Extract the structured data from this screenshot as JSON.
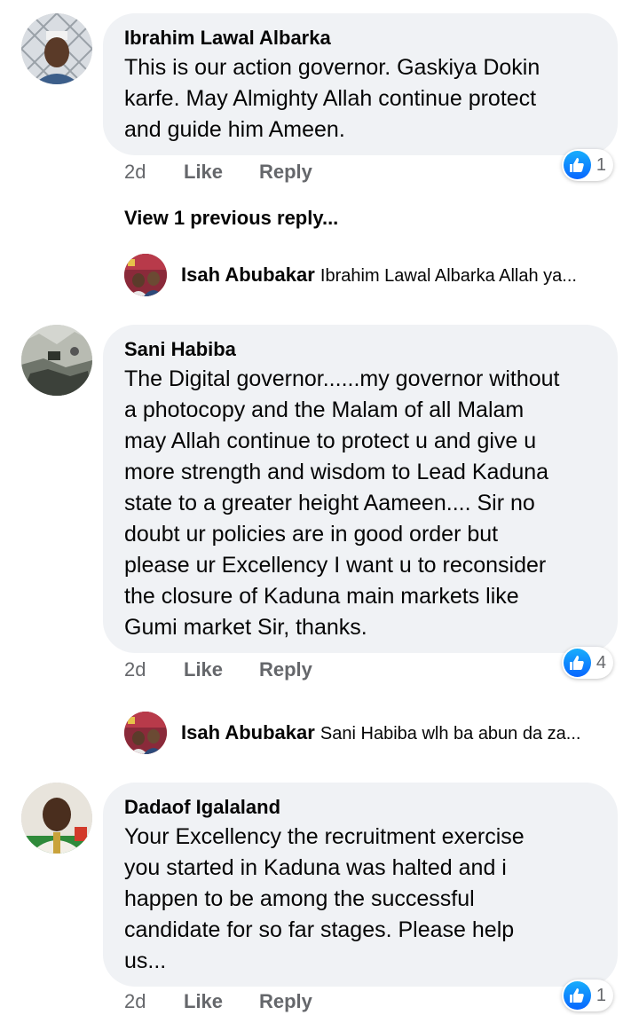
{
  "comments": [
    {
      "author": "Ibrahim Lawal Albarka",
      "lines": [
        "This is our action governor. Gaskiya Dokin",
        "karfe. May Almighty Allah continue protect",
        "and guide him Ameen."
      ],
      "time": "2d",
      "like_label": "Like",
      "reply_label": "Reply",
      "reaction_count": "1"
    },
    {
      "author": "Sani Habiba",
      "lines": [
        "The Digital governor......my governor without",
        "a photocopy and the Malam of all Malam",
        "may Allah continue to protect u and give u",
        "more strength and wisdom to Lead Kaduna",
        "state to a greater height Aameen.... Sir no",
        "doubt ur policies are in good order but",
        "please ur Excellency I want u to reconsider",
        "the closure of Kaduna main markets like",
        "Gumi market Sir, thanks."
      ],
      "time": "2d",
      "like_label": "Like",
      "reply_label": "Reply",
      "reaction_count": "4"
    },
    {
      "author": "Dadaof Igalaland",
      "lines": [
        "Your Excellency the recruitment exercise",
        "you started in Kaduna was halted and i",
        "happen to be among the successful",
        "candidate for so far stages. Please help",
        "us..."
      ],
      "time": "2d",
      "like_label": "Like",
      "reply_label": "Reply",
      "reaction_count": "1"
    }
  ],
  "view_previous": "View 1 previous reply...",
  "replies": [
    {
      "author": "Isah Abubakar",
      "preview": "Ibrahim Lawal Albarka Allah ya..."
    },
    {
      "author": "Isah Abubakar",
      "preview": "Sani Habiba wlh ba abun da za..."
    }
  ],
  "colors": {
    "bubble": "#f0f2f5",
    "secondary_text": "#65676b",
    "like_blue": "#0866ff"
  }
}
